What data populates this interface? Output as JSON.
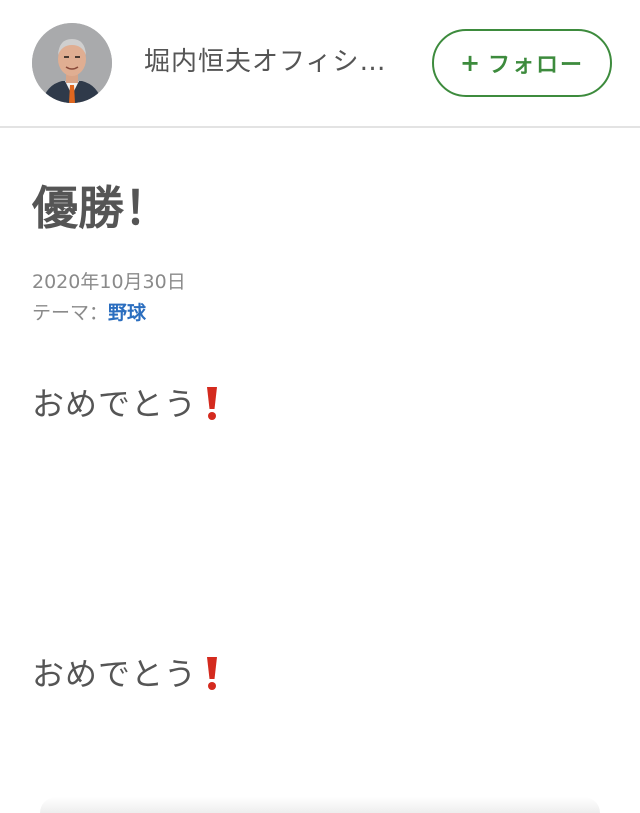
{
  "header": {
    "blog_name": "堀内恒夫オフィシ…",
    "follow_label": "フォロー",
    "follow_plus": "+"
  },
  "article": {
    "title": "優勝！",
    "date": "2020年10月30日",
    "theme_label": "テーマ：",
    "theme_value": "野球",
    "lines": [
      "おめでとう",
      "おめでとう"
    ]
  },
  "colors": {
    "follow_green": "#3d8b3d",
    "theme_link_blue": "#2b6ebf",
    "exclamation_red": "#d42a1e"
  },
  "icons": {
    "exclamation": "heavy-exclamation-mark-icon",
    "avatar": "profile-photo"
  }
}
